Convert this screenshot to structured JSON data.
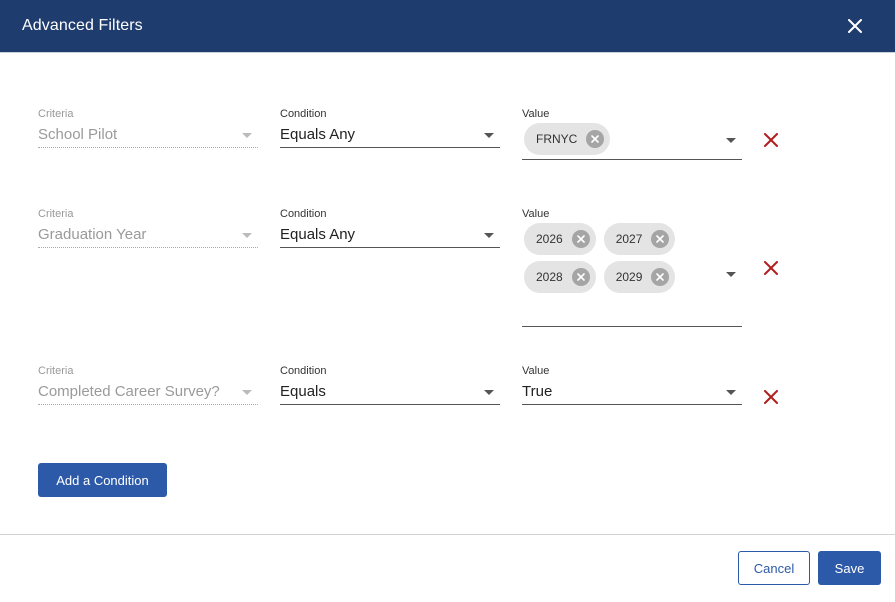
{
  "dialog": {
    "title": "Advanced Filters"
  },
  "filters": [
    {
      "criteria_label": "Criteria",
      "criteria_value": "School Pilot",
      "condition_label": "Condition",
      "condition_value": "Equals Any",
      "value_label": "Value",
      "chips": [
        "FRNYC"
      ]
    },
    {
      "criteria_label": "Criteria",
      "criteria_value": "Graduation Year",
      "condition_label": "Condition",
      "condition_value": "Equals Any",
      "value_label": "Value",
      "chips": [
        "2026",
        "2027",
        "2028",
        "2029"
      ]
    },
    {
      "criteria_label": "Criteria",
      "criteria_value": "Completed Career Survey?",
      "condition_label": "Condition",
      "condition_value": "Equals",
      "value_label": "Value",
      "value_text": "True"
    }
  ],
  "actions": {
    "add_condition": "Add a Condition",
    "cancel": "Cancel",
    "save": "Save"
  },
  "icons": {
    "close": "close-icon",
    "chip_remove": "x-circle-icon",
    "delete_row": "x-icon",
    "dropdown": "caret-down-icon"
  },
  "colors": {
    "header_bg": "#1f3c6e",
    "primary": "#2d5aa8",
    "delete": "#b21d1d",
    "chip_bg": "#e4e4e4"
  }
}
